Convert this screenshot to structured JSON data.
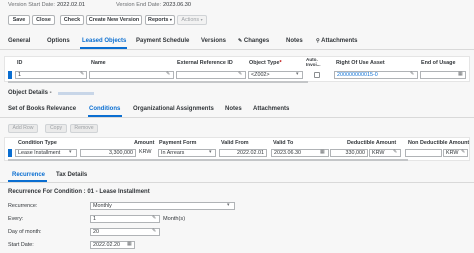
{
  "header": {
    "version_start_label": "Version Start Date:",
    "version_start_value": "2022.02.01",
    "version_end_label": "Version End Date:",
    "version_end_value": "2023.06.30"
  },
  "toolbar": {
    "save": "Save",
    "close": "Close",
    "check": "Check",
    "create_new_version": "Create New Version",
    "reports": "Reports",
    "actions": "Actions"
  },
  "main_tabs": [
    "General",
    "Options",
    "Leased Objects",
    "Payment Schedule",
    "Versions",
    "Changes",
    "Notes",
    "Attachments"
  ],
  "objects_table": {
    "headers": [
      "ID",
      "Name",
      "External Reference ID",
      "Object Type",
      "Auto. Invoi...",
      "Right Of Use Asset",
      "End of Usage"
    ],
    "row": {
      "id": "1",
      "name": "",
      "external_ref": "",
      "object_type": "<Z002>",
      "right_of_use_asset": "200000000015-0",
      "end_of_usage": ""
    }
  },
  "object_details_label": "Object Details -",
  "sub_tabs": [
    "Set of Books Relevance",
    "Conditions",
    "Organizational Assignments",
    "Notes",
    "Attachments"
  ],
  "cond_toolbar": {
    "add_row": "Add Row",
    "copy": "Copy",
    "remove": "Remove"
  },
  "conditions_table": {
    "headers": [
      "Condition Type",
      "Amount",
      "Payment Form",
      "Valid From",
      "Valid To",
      "Deductible Amount",
      "Non Deductible Amount"
    ],
    "row": {
      "condition_type": "Lease Installment",
      "amount": "3,300,000",
      "currency": "KRW",
      "payment_form": "In Arrears",
      "valid_from": "2022.02.01",
      "valid_to": "2023.06.30",
      "deductible_amount": "330,000",
      "deductible_currency": "KRW",
      "non_deductible_currency": "KRW"
    }
  },
  "detail_tabs": [
    "Recurrence",
    "Tax Details"
  ],
  "recurrence": {
    "section_title": "Recurrence For Condition : 01 - Lease Installment",
    "recurrence_label": "Recurrence:",
    "recurrence_value": "Monthly",
    "every_label": "Every:",
    "every_value": "1",
    "every_unit": "Month(s)",
    "day_label": "Day of month:",
    "day_value": "20",
    "start_label": "Start Date:",
    "start_value": "2022.02.20"
  },
  "colors": {
    "accent": "#0a6ed1",
    "background": "#f7f7f7"
  }
}
